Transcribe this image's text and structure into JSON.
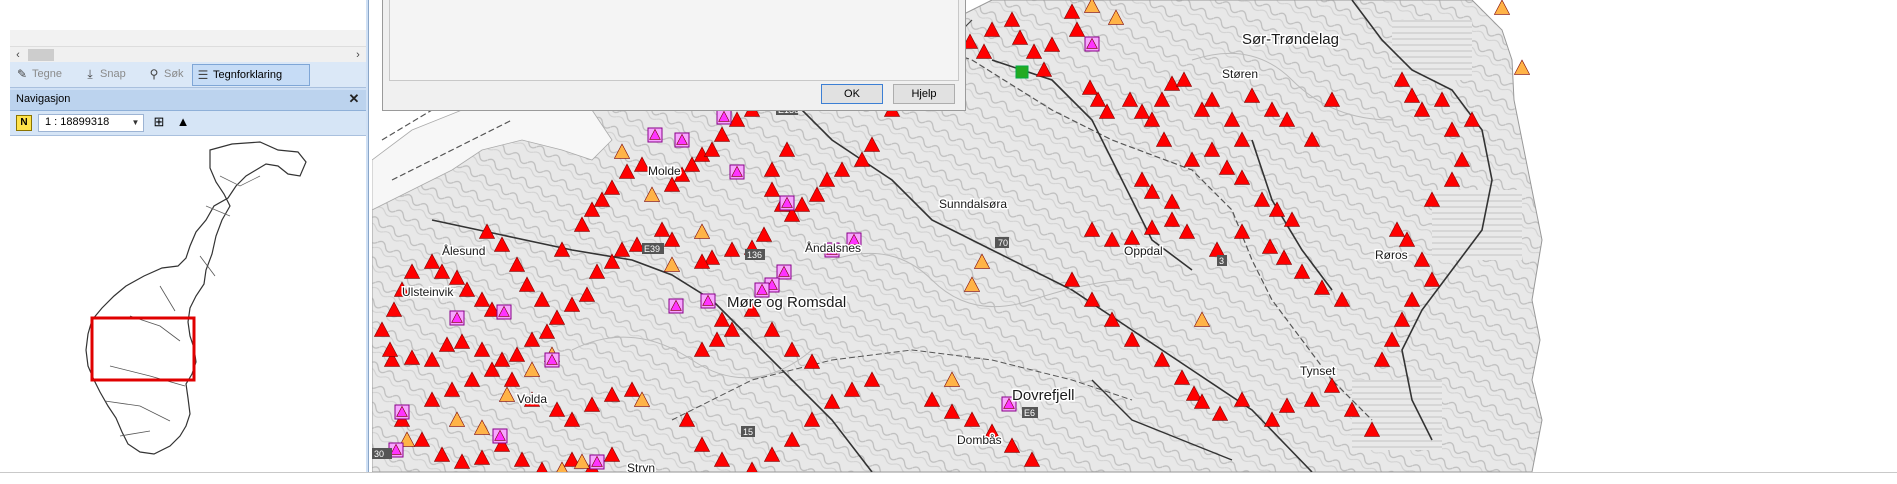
{
  "toolbar": {
    "tabs": [
      {
        "label": "Tegne",
        "icon": "pencil-icon"
      },
      {
        "label": "Snap",
        "icon": "snap-icon"
      },
      {
        "label": "Søk",
        "icon": "search-icon"
      },
      {
        "label": "Tegnforklaring",
        "icon": "legend-icon"
      }
    ]
  },
  "navigation": {
    "title": "Navigasjon",
    "close_icon": "close-icon",
    "north_icon_label": "N",
    "scale": "1 : 18899318"
  },
  "dialog": {
    "ok_label": "OK",
    "help_label": "Hjelp"
  },
  "map": {
    "region_labels": [
      "Sør-Trøndelag",
      "Møre og Romsdal"
    ],
    "place_labels": [
      "Støren",
      "Sunndalsøra",
      "Åndalsnes",
      "Ålesund",
      "Ulsteinvik",
      "Volda",
      "Oppdal",
      "Røros",
      "Dovrefjell",
      "Dombås",
      "Tynset",
      "Stryn",
      "Molde"
    ],
    "road_labels": [
      "E39",
      "136",
      "70",
      "15",
      "E136",
      "E6",
      "3",
      "30"
    ],
    "colors": {
      "red_marker": "#ff0000",
      "orange_marker": "#ffb347",
      "magenta_marker": "#ff33ff",
      "green_marker": "#22aa22",
      "viewport_box": "#e00000",
      "panel_bg": "#cfe0f5"
    }
  }
}
